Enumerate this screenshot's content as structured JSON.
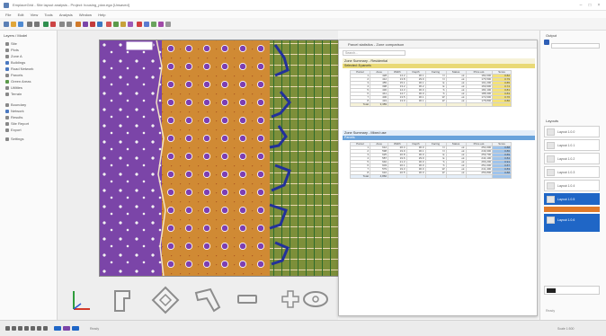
{
  "window": {
    "title": "EmplaceGrid - Site layout analysis - Project: housing_plan.ega [Unsaved]"
  },
  "menu": [
    "File",
    "Edit",
    "View",
    "Tools",
    "Analysis",
    "Window",
    "Help"
  ],
  "left_panel": {
    "title": "Layers / Model",
    "items": [
      "Site",
      "Plots",
      "Zone A",
      "Buildings",
      "Road Network",
      "Parcels",
      "Green Areas",
      "Utilities",
      "Terrain",
      "Boundary",
      "Network",
      "Results",
      "Site Report",
      "Export",
      "Settings"
    ]
  },
  "window_table": {
    "title": "Parcel statistics - Zone comparison",
    "search_placeholder": "Search...",
    "section1": {
      "head": "Zone Summary - Residential",
      "bar": "Selected: 8 parcels",
      "columns": [
        "Parcel",
        "Area",
        "Width",
        "Depth",
        "Facing",
        "Status",
        "Price est.",
        "Score"
      ],
      "rows": [
        [
          "1",
          "428",
          "14.2",
          "30.1",
          "N",
          "ok",
          "182,000",
          "0.82"
        ],
        [
          "2",
          "412",
          "13.8",
          "29.9",
          "N",
          "ok",
          "176,500",
          "0.79"
        ],
        [
          "3",
          "455",
          "15.1",
          "30.1",
          "E",
          "ok",
          "191,200",
          "0.85"
        ],
        [
          "4",
          "398",
          "13.2",
          "30.2",
          "E",
          "ok",
          "169,900",
          "0.74"
        ],
        [
          "5",
          "430",
          "14.3",
          "30.0",
          "S",
          "ok",
          "184,100",
          "0.81"
        ],
        [
          "6",
          "441",
          "14.7",
          "30.0",
          "S",
          "ok",
          "188,300",
          "0.83"
        ],
        [
          "7",
          "406",
          "13.5",
          "30.1",
          "W",
          "ok",
          "172,600",
          "0.76"
        ],
        [
          "8",
          "419",
          "13.9",
          "30.1",
          "W",
          "ok",
          "178,800",
          "0.80"
        ]
      ],
      "total_label": "Total",
      "total_area": "3,389"
    },
    "section2": {
      "head": "Zone Summary - Mixed use",
      "bar": "Parcels",
      "columns": [
        "Parcel",
        "Area",
        "Width",
        "Depth",
        "Facing",
        "Status",
        "Price est.",
        "Score"
      ],
      "rows": [
        [
          "1",
          "612",
          "20.4",
          "30.0",
          "N",
          "ok",
          "254,000",
          "0.88"
        ],
        [
          "2",
          "598",
          "19.9",
          "30.1",
          "N",
          "ok",
          "249,300",
          "0.86"
        ],
        [
          "3",
          "625",
          "20.8",
          "30.0",
          "E",
          "ok",
          "259,700",
          "0.89"
        ],
        [
          "4",
          "587",
          "19.6",
          "29.9",
          "E",
          "ok",
          "244,100",
          "0.84"
        ],
        [
          "5",
          "640",
          "21.3",
          "30.0",
          "S",
          "ok",
          "266,200",
          "0.91"
        ],
        [
          "6",
          "603",
          "20.1",
          "30.0",
          "S",
          "ok",
          "251,000",
          "0.87"
        ],
        [
          "7",
          "579",
          "19.3",
          "30.0",
          "W",
          "ok",
          "241,400",
          "0.83"
        ],
        [
          "8",
          "616",
          "20.5",
          "30.0",
          "W",
          "ok",
          "256,800",
          "0.88"
        ]
      ],
      "total_label": "Total",
      "total_area": "4,860"
    }
  },
  "right_panel": {
    "title": "Output",
    "list_title": "Layouts",
    "items": [
      "Layout 1.0.0",
      "Layout 1.0.1",
      "Layout 1.0.2",
      "Layout 1.0.3",
      "Layout 1.0.4",
      "Layout 1.0.5",
      "Layout 1.0.6"
    ],
    "selected_index": 5,
    "footer": "Ready"
  },
  "statusbar": {
    "left": "Ready",
    "right": "Scale 1:500"
  },
  "colors": {
    "purple_zone": "#7b45a8",
    "orange_zone": "#d08a34",
    "green_zone": "#7d8f3a",
    "selection": "#1f66c6",
    "table_highlight_yellow": "#f4e27a",
    "table_highlight_blue": "#9fc4ec"
  },
  "icons": [
    "app-icon",
    "minimize-icon",
    "maximize-icon",
    "close-icon",
    "axis-gizmo-icon",
    "l-shape-icon",
    "diamond-shape-icon",
    "angle-shape-icon",
    "rect-shape-icon",
    "cross-shape-icon",
    "capsule-shape-icon"
  ]
}
